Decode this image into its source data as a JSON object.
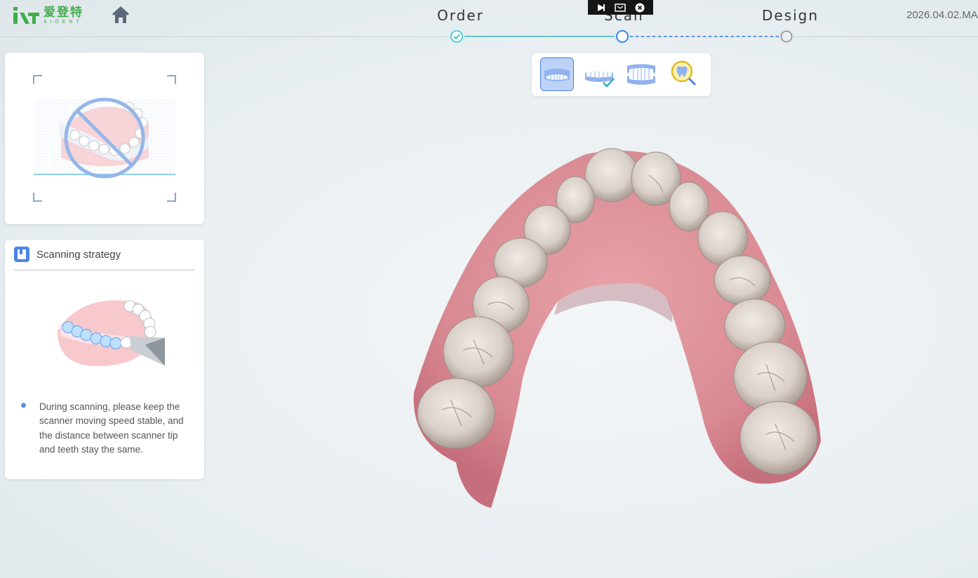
{
  "brand": {
    "name_cn": "爱登特",
    "name_en": "AIDENT",
    "color": "#3fae49"
  },
  "nav": {
    "home_icon": "home-icon"
  },
  "workflow": {
    "steps": [
      {
        "label": "Order",
        "status": "completed"
      },
      {
        "label": "Scan",
        "status": "current"
      },
      {
        "label": "Design",
        "status": "pending"
      }
    ],
    "accent_color": "#3bbfc4",
    "current_color": "#2f7de1"
  },
  "date_text": "2026.04.02.MA",
  "floating_toolbar": {
    "icons": [
      "cursor-icon",
      "screen-icon",
      "close-icon"
    ]
  },
  "view_toolbar": {
    "items": [
      {
        "icon": "upper-jaw-icon",
        "active": true
      },
      {
        "icon": "lower-jaw-check-icon",
        "active": false
      },
      {
        "icon": "bite-icon",
        "active": false
      },
      {
        "icon": "tooth-inspect-icon",
        "active": false
      }
    ]
  },
  "preview_card": {
    "icon": "no-scan-icon"
  },
  "strategy": {
    "title": "Scanning strategy",
    "tips": [
      "During scanning, please keep the scanner moving speed stable, and the distance between scanner tip and teeth stay the same."
    ]
  }
}
